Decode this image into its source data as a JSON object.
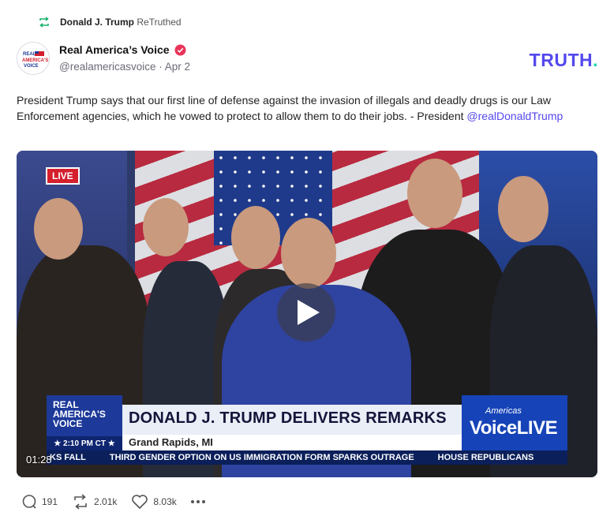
{
  "retruth": {
    "icon": "retruth-icon",
    "user": "Donald J. Trump",
    "action": "ReTruthed"
  },
  "post": {
    "author": {
      "name": "Real America’s Voice",
      "verified_icon": "verified-badge-icon",
      "handle": "@realamericasvoice",
      "separator": "·",
      "date": "Apr 2",
      "avatar_text": "REAL AMERICA'S VOICE"
    },
    "brand_logo": {
      "text": "TRUTH",
      "dot": ".",
      "color": "#5448ee",
      "dot_color": "#20d3b0"
    },
    "text": "President Trump says that our first line of defense against the invasion of illegals and deadly drugs is our Law Enforcement agencies, which he vowed to protect to allow them to do their jobs. - President ",
    "mention": "@realDonaldTrump",
    "video": {
      "live_badge": "LIVE",
      "duration": "01:28",
      "play_icon": "play-icon",
      "lower_third": {
        "logo_line1": "REAL",
        "logo_line2": "AMERICA'S",
        "logo_line3": "VOICE",
        "time": "★ 2:10 PM CT ★",
        "headline": "DONALD J. TRUMP DELIVERS REMARKS",
        "location": "Grand Rapids, MI",
        "right_small": "Americas",
        "right_big": "VoiceLIVE"
      },
      "ticker": [
        "KS FALL",
        "THIRD GENDER OPTION ON US IMMIGRATION FORM SPARKS OUTRAGE",
        "HOUSE REPUBLICANS"
      ]
    },
    "actions": {
      "replies": "191",
      "retruths": "2.01k",
      "likes": "8.03k"
    }
  },
  "colors": {
    "accent": "#5448ee",
    "verified": "#e8345a",
    "live": "#d41f2d"
  }
}
